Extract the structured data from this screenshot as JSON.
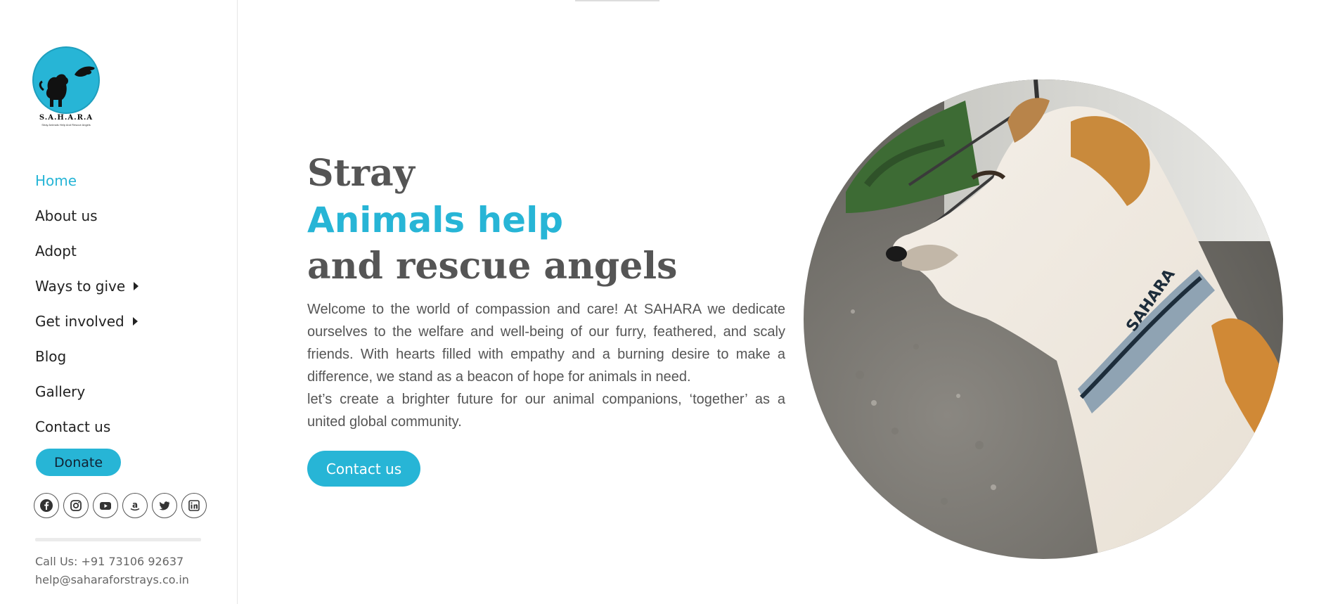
{
  "logo": {
    "name": "S.A.H.A.R.A",
    "tagline": "Stray Animals Help And Rescue Angels"
  },
  "nav": {
    "items": [
      {
        "label": "Home",
        "active": true
      },
      {
        "label": "About us"
      },
      {
        "label": "Adopt"
      },
      {
        "label": "Ways to give",
        "has_submenu": true
      },
      {
        "label": "Get involved",
        "has_submenu": true
      },
      {
        "label": "Blog"
      },
      {
        "label": "Gallery"
      },
      {
        "label": "Contact us"
      }
    ]
  },
  "sidebar": {
    "donate_label": "Donate",
    "socials": [
      "facebook-icon",
      "instagram-icon",
      "youtube-icon",
      "amazon-icon",
      "twitter-icon",
      "linkedin-icon"
    ],
    "phone": "Call Us: +91 73106 92637",
    "email": "help@saharaforstrays.co.in"
  },
  "hero": {
    "line1": "Stray",
    "line2": "Animals help",
    "line3": "and rescue angels",
    "paragraph1": "Welcome to the world of compassion and care! At SAHARA we dedicate ourselves to the welfare and well-being of our furry, feathered, and scaly friends. With hearts filled with empathy and a burning desire to make a difference, we stand as a beacon of hope for animals in need.",
    "paragraph2": "let’s create a brighter future for our animal companions, ‘together’ as a united global community.",
    "button_label": "Contact us",
    "image_collar_text": "SAHARA"
  },
  "colors": {
    "accent": "#27b5d6",
    "heading": "#555555",
    "text": "#555555"
  }
}
